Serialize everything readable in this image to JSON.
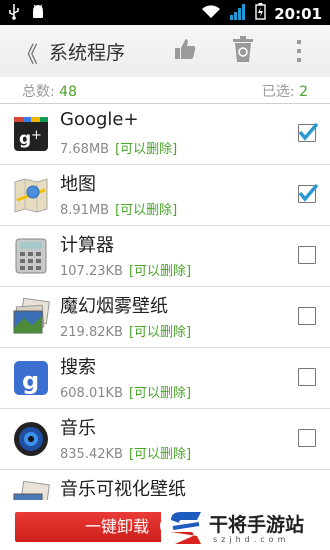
{
  "status": {
    "time": "20:01"
  },
  "header": {
    "back": "《",
    "title": "系统程序"
  },
  "summary": {
    "total_label": "总数:",
    "total": "48",
    "selected_label": "已选:",
    "selected": "2"
  },
  "apps": [
    {
      "name": "Google+",
      "size": "7.68MB",
      "tag": "[可以删除]",
      "checked": true
    },
    {
      "name": "地图",
      "size": "8.91MB",
      "tag": "[可以删除]",
      "checked": true
    },
    {
      "name": "计算器",
      "size": "107.23KB",
      "tag": "[可以删除]",
      "checked": false
    },
    {
      "name": "魔幻烟雾壁纸",
      "size": "219.82KB",
      "tag": "[可以删除]",
      "checked": false
    },
    {
      "name": "搜索",
      "size": "608.01KB",
      "tag": "[可以删除]",
      "checked": false
    },
    {
      "name": "音乐",
      "size": "835.42KB",
      "tag": "[可以删除]",
      "checked": false
    },
    {
      "name": "音乐可视化壁纸",
      "size": "",
      "tag": "",
      "checked": false
    }
  ],
  "bottom": {
    "uninstall_label": "一键卸载（16"
  },
  "watermark": {
    "text": "干将手游站",
    "sub": "szjhd.com"
  },
  "colors": {
    "accent_green": "#4aa52a",
    "button_red": "#d8231f",
    "checkbox_blue": "#2c9ad1"
  }
}
